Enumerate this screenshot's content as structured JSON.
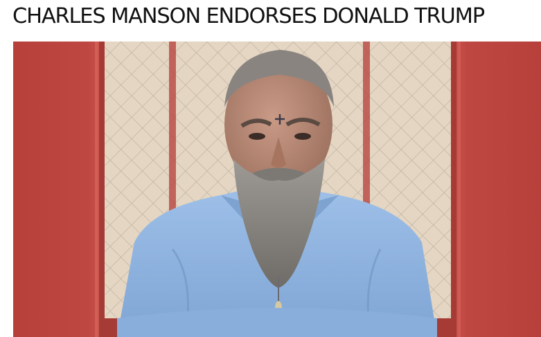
{
  "article": {
    "headline": "CHARLES MANSON ENDORSES DONALD TRUMP"
  },
  "photo": {
    "subject": "Charles Manson",
    "colors": {
      "wall_red": "#c84a44",
      "frame_red": "#d4544d",
      "shirt_blue": "#8fb4e0",
      "beard_gray": "#8c8a86",
      "skin": "#b98b78",
      "tile": "#e6d9c6"
    }
  }
}
